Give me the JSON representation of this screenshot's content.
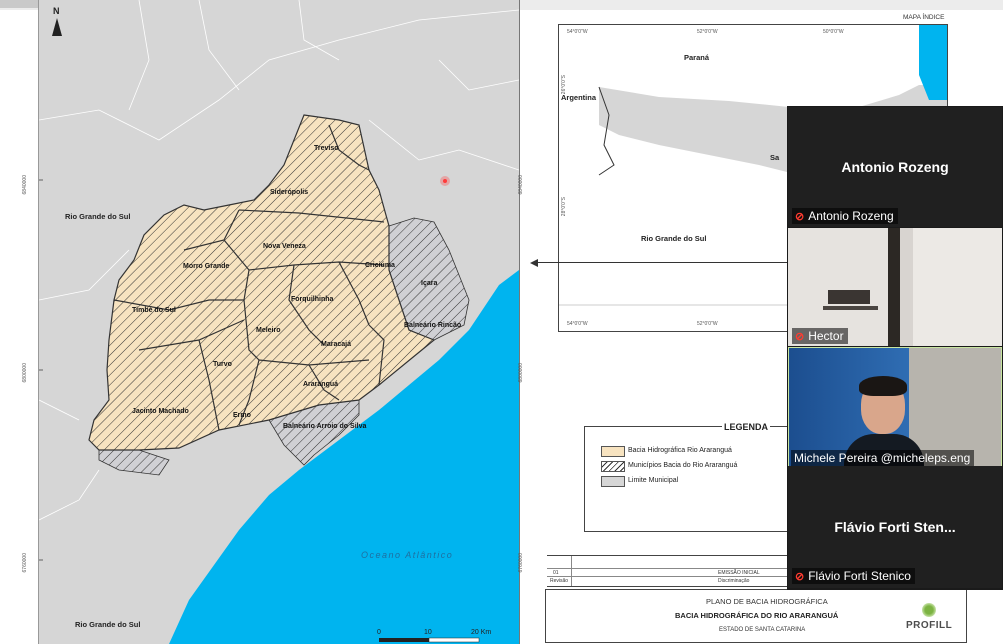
{
  "map": {
    "north": "N",
    "states": {
      "rs_top": "Rio Grande do Sul",
      "rs_bottom": "Rio Grande do Sul"
    },
    "ocean": "Oceano Atlântico",
    "municipalities": {
      "treviso": "Treviso",
      "sideropolis": "Siderópolis",
      "nova_veneza": "Nova Veneza",
      "morro_grande": "Morro Grande",
      "criciuma": "Criciúma",
      "icara": "Içara",
      "forquilhinha": "Forquilhinha",
      "timbe": "Timbé do Sul",
      "meleiro": "Meleiro",
      "maracaja": "Maracajá",
      "rincao": "Balneário Rincão",
      "turvo": "Turvo",
      "ararangua": "Araranguá",
      "jacinto": "Jacinto Machado",
      "ermo": "Ermo",
      "arroio": "Balneário Arroio do Silva"
    },
    "scale": {
      "s0": "0",
      "s10": "10",
      "s20": "20 Km"
    },
    "coords": {
      "y1": "6840000",
      "y2": "6800000",
      "y3": "6760000"
    }
  },
  "index_map": {
    "title": "MAPA ÍNDICE",
    "parana": "Paraná",
    "argentina": "Argentina",
    "santa_catarina": "Sa",
    "rs": "Rio Grande do Sul",
    "ticks": {
      "t1": "54°0'0\"W",
      "t2": "52°0'0\"W",
      "t3": "50°0'0\"W"
    },
    "lat": {
      "l1": "26°0'0\"S",
      "l2": "28°0'0\"S"
    }
  },
  "legend": {
    "title": "LEGENDA",
    "items": {
      "basin": "Bacia Hidrográfica Rio Araranguá",
      "municipalities": "Municípios Bacia do Rio Araranguá",
      "limit": "Limite Municipal"
    }
  },
  "title_block": {
    "emissao": "EMISSÃO INICIAL",
    "rev_label": "Revisão",
    "desc_label": "Discriminação",
    "rev0": "01",
    "plan": "PLANO DE BACIA HIDROGRÁFICA",
    "basin": "BACIA HIDROGRÁFICA DO RIO ARARANGUÁ",
    "state": "ESTADO DE SANTA CATARINA",
    "logo": "PROFILL"
  },
  "participants": {
    "p1": {
      "name": "Antonio Rozeng",
      "label": "Antonio Rozeng"
    },
    "p2": {
      "label": "Hector"
    },
    "p3": {
      "label": "Michele Pereira @micheleps.eng"
    },
    "p4": {
      "name": "Flávio  Forti  Sten...",
      "label": "Flávio Forti Stenico"
    }
  },
  "colors": {
    "basin": "#f7e3c0",
    "ocean": "#00b4ef",
    "land": "#d6d6d6",
    "tile": "#202020",
    "speaker_border": "#c8e6a0"
  }
}
